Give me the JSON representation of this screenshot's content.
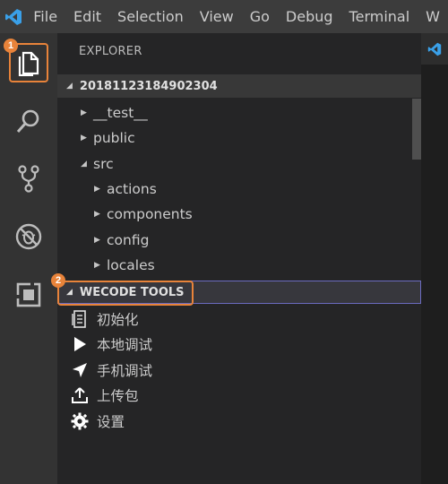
{
  "menubar": {
    "items": [
      "File",
      "Edit",
      "Selection",
      "View",
      "Go",
      "Debug",
      "Terminal",
      "W"
    ]
  },
  "activity_bar": {
    "items": [
      {
        "icon": "files-icon",
        "badge": "1"
      },
      {
        "icon": "search-icon"
      },
      {
        "icon": "source-control-icon"
      },
      {
        "icon": "debug-icon"
      },
      {
        "icon": "extensions-icon"
      }
    ]
  },
  "explorer": {
    "title": "EXPLORER",
    "project": "20181123184902304",
    "tree": [
      {
        "label": "__test__",
        "arrow": "▶",
        "depth": 1
      },
      {
        "label": "public",
        "arrow": "▶",
        "depth": 1
      },
      {
        "label": "src",
        "arrow": "◢",
        "depth": 1
      },
      {
        "label": "actions",
        "arrow": "▶",
        "depth": 2
      },
      {
        "label": "components",
        "arrow": "▶",
        "depth": 2
      },
      {
        "label": "config",
        "arrow": "▶",
        "depth": 2
      },
      {
        "label": "locales",
        "arrow": "▶",
        "depth": 2
      }
    ]
  },
  "wecode": {
    "title": "WECODE TOOLS",
    "badge": "2",
    "items": [
      {
        "label": "初始化",
        "icon": "document-list-icon"
      },
      {
        "label": "本地调试",
        "icon": "play-icon"
      },
      {
        "label": "手机调试",
        "icon": "send-icon"
      },
      {
        "label": "上传包",
        "icon": "upload-icon"
      },
      {
        "label": "设置",
        "icon": "gear-icon"
      }
    ]
  },
  "colors": {
    "accent": "#e8833a",
    "vscode_blue": "#3aa0e8"
  }
}
